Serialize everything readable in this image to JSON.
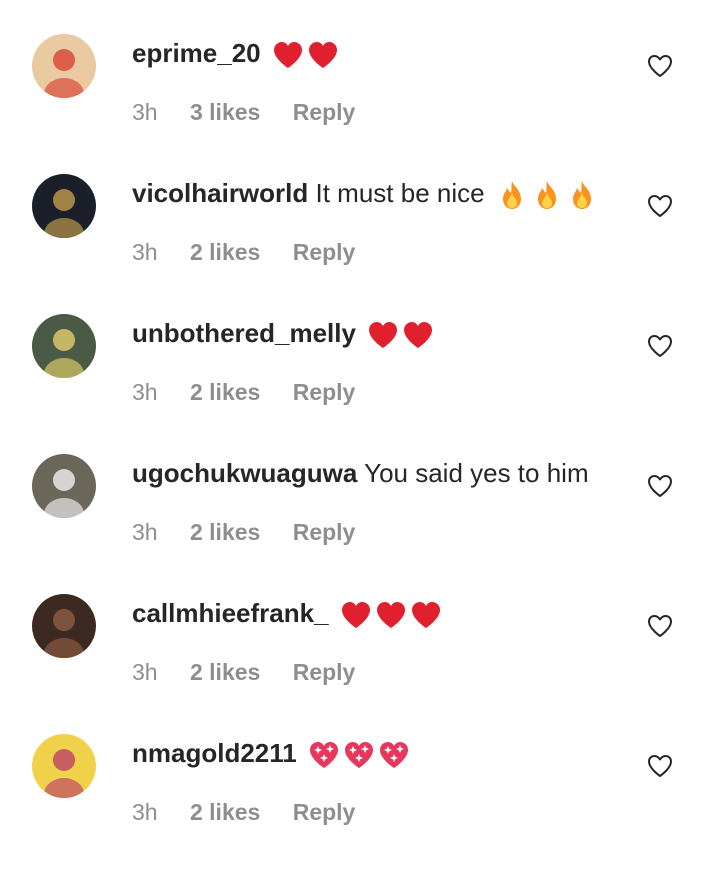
{
  "colors": {
    "username": "#262626",
    "meta": "#8e8e8e",
    "heart_red": "#e0202e",
    "fire_orange": "#f7931e",
    "sparkle_heart": "#e8365d"
  },
  "comments": [
    {
      "username": "eprime_20",
      "text": "",
      "emoji": [
        "red-heart",
        "red-heart"
      ],
      "time": "3h",
      "likes": "3 likes",
      "reply": "Reply",
      "avatar": {
        "bg": "#e8c9a0",
        "fg": "#d94b3a"
      }
    },
    {
      "username": "vicolhairworld",
      "text": "It must be nice",
      "emoji": [
        "fire",
        "fire",
        "fire"
      ],
      "time": "3h",
      "likes": "2 likes",
      "reply": "Reply",
      "avatar": {
        "bg": "#1b1f2a",
        "fg": "#b8974a"
      }
    },
    {
      "username": "unbothered_melly",
      "text": "",
      "emoji": [
        "red-heart",
        "red-heart"
      ],
      "time": "3h",
      "likes": "2 likes",
      "reply": "Reply",
      "avatar": {
        "bg": "#4a5a44",
        "fg": "#d8c86a"
      }
    },
    {
      "username": "ugochukwuaguwa",
      "text": "You said yes to him",
      "emoji": [],
      "time": "3h",
      "likes": "2 likes",
      "reply": "Reply",
      "avatar": {
        "bg": "#6a6658",
        "fg": "#e8e8ea"
      }
    },
    {
      "username": "callmhieefrank_",
      "text": "",
      "emoji": [
        "red-heart",
        "red-heart",
        "red-heart"
      ],
      "time": "3h",
      "likes": "2 likes",
      "reply": "Reply",
      "avatar": {
        "bg": "#3c2a22",
        "fg": "#8a5a40"
      }
    },
    {
      "username": "nmagold2211",
      "text": "",
      "emoji": [
        "sparkling-heart",
        "sparkling-heart",
        "sparkling-heart"
      ],
      "time": "3h",
      "likes": "2 likes",
      "reply": "Reply",
      "avatar": {
        "bg": "#f0d24a",
        "fg": "#c14a66"
      }
    }
  ]
}
